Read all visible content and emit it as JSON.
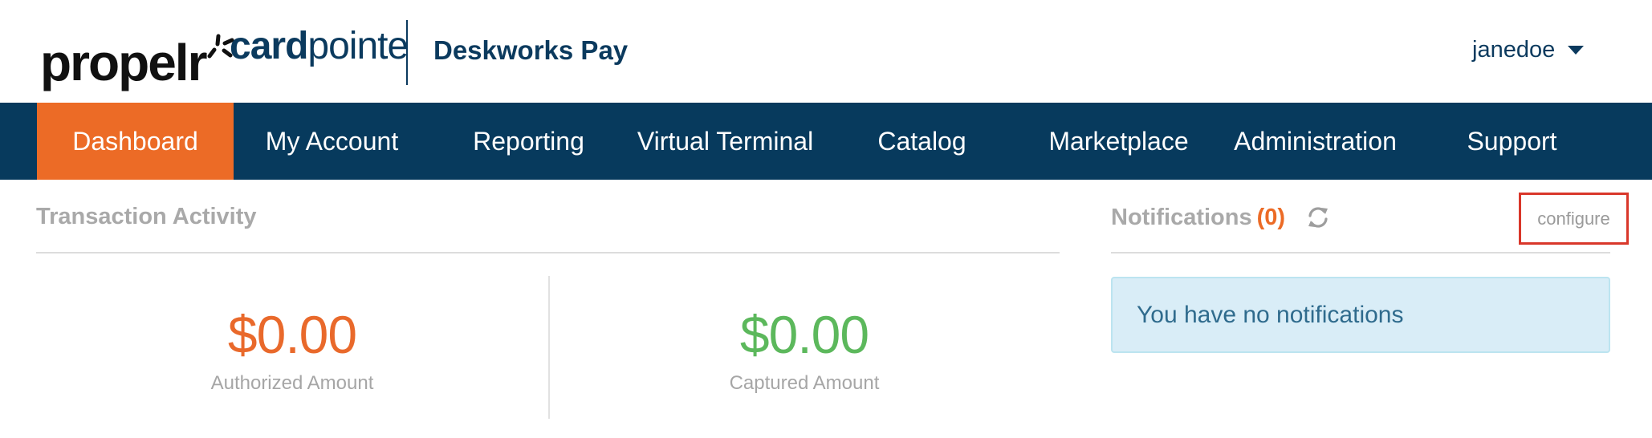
{
  "header": {
    "brand_logo": "propelr",
    "product_logo_bold": "card",
    "product_logo_light": "pointe",
    "app_name": "Deskworks Pay",
    "username": "janedoe",
    "brand_color": "#073a5d",
    "accent_color": "#ec6b26"
  },
  "nav": {
    "items": [
      {
        "label": "Dashboard",
        "active": true
      },
      {
        "label": "My Account",
        "active": false
      },
      {
        "label": "Reporting",
        "active": false
      },
      {
        "label": "Virtual Terminal",
        "active": false
      },
      {
        "label": "Catalog",
        "active": false
      },
      {
        "label": "Marketplace",
        "active": false
      },
      {
        "label": "Administration",
        "active": false
      },
      {
        "label": "Support",
        "active": false
      }
    ]
  },
  "transaction_activity": {
    "title": "Transaction Activity",
    "authorized": {
      "amount": "$0.00",
      "label": "Authorized Amount",
      "color": "#e9692b"
    },
    "captured": {
      "amount": "$0.00",
      "label": "Captured Amount",
      "color": "#5cb85c"
    }
  },
  "notifications": {
    "title": "Notifications",
    "count": "(0)",
    "refresh_icon": "refresh-icon",
    "configure_label": "configure",
    "empty_message": "You have no notifications"
  }
}
